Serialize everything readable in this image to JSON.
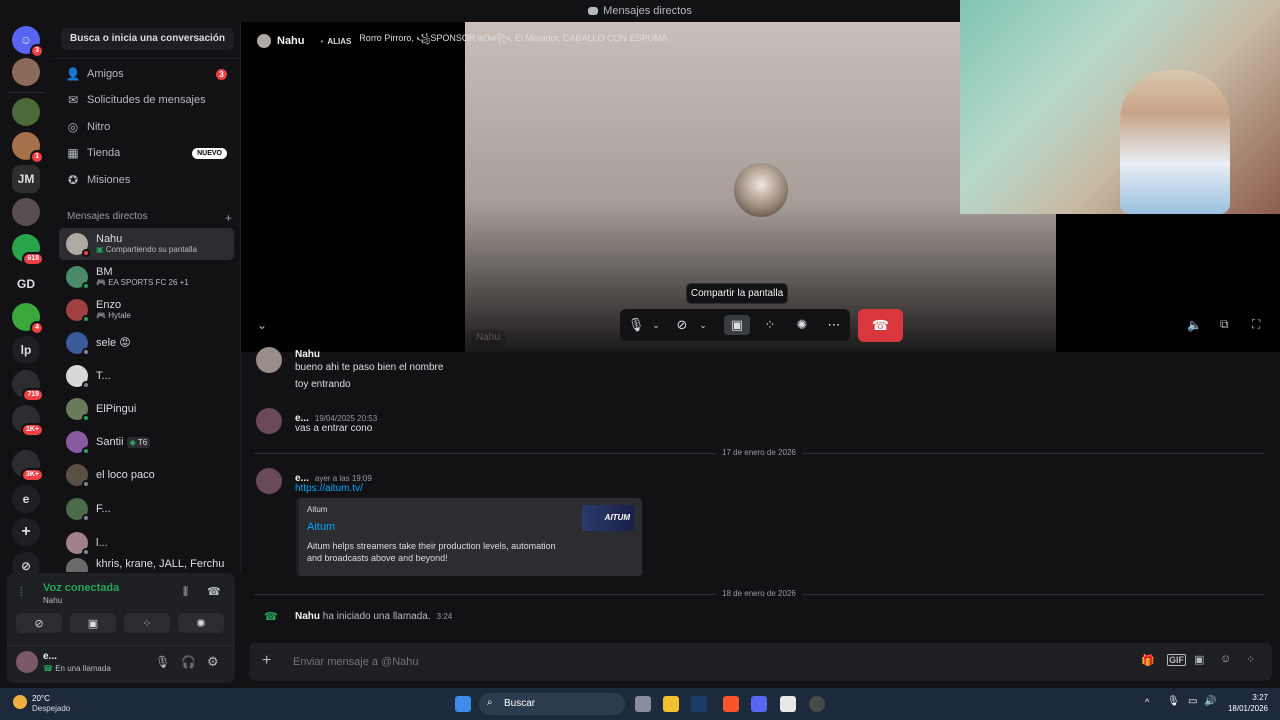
{
  "titlebar": {
    "title": "Mensajes directos"
  },
  "servers": [
    {
      "label": "",
      "badge": "3"
    },
    {
      "label": "",
      "badge": ""
    },
    {
      "label": "",
      "badge": ""
    },
    {
      "label": "",
      "badge": "1"
    },
    {
      "label": "JM",
      "badge": ""
    },
    {
      "label": "",
      "badge": ""
    },
    {
      "label": "",
      "badge": "618"
    },
    {
      "label": "GD",
      "badge": ""
    },
    {
      "label": "",
      "badge": "4"
    },
    {
      "label": "lp",
      "badge": ""
    },
    {
      "label": "",
      "badge": "719"
    },
    {
      "label": "",
      "badge": "1K+"
    },
    {
      "label": "",
      "badge": "3K+"
    },
    {
      "label": "e",
      "badge": ""
    },
    {
      "label": "+",
      "badge": ""
    },
    {
      "label": "⊘",
      "badge": ""
    }
  ],
  "sidebar": {
    "search": "Busca o inicia una conversación",
    "nav": [
      {
        "label": "Amigos",
        "badge": "3"
      },
      {
        "label": "Solicitudes de mensajes",
        "badge": ""
      },
      {
        "label": "Nitro",
        "badge": ""
      },
      {
        "label": "Tienda",
        "badge": "NUEVO"
      },
      {
        "label": "Misiones",
        "badge": ""
      }
    ],
    "dm_header": "Mensajes directos",
    "dm_add": "+",
    "dms": [
      {
        "name": "Nahu",
        "sub": "Compartiendo su pantalla"
      },
      {
        "name": "BM",
        "sub": "EA SPORTS FC 26 +1"
      },
      {
        "name": "Enzo",
        "sub": "Hytale"
      },
      {
        "name": "sele 😡",
        "sub": ""
      },
      {
        "name": "T...",
        "sub": ""
      },
      {
        "name": "ElPingui",
        "sub": ""
      },
      {
        "name": "Santii",
        "sub": "",
        "tag": "T6"
      },
      {
        "name": "el loco paco",
        "sub": ""
      },
      {
        "name": "F...",
        "sub": ""
      },
      {
        "name": "l...",
        "sub": ""
      },
      {
        "name": "khris, krane, JALL, Ferchu",
        "sub": ""
      }
    ]
  },
  "voice": {
    "status": "Voz conectada",
    "channel": "Nahu",
    "user": "e...",
    "user_sub": "En una llamada"
  },
  "call": {
    "name": "Nahu",
    "alias_label": "ALIAS",
    "aliases": "Rorro Pirroro, ꧁SPONSOR w0w꧂, El Matador, CABALLO CON ESPUMA",
    "screen_label": "Nahu",
    "tooltip": "Compartir la pantalla"
  },
  "chat": {
    "messages": [
      {
        "user": "Nahu",
        "time": "",
        "lines": [
          "bueno ahi te paso bien el nombre",
          "toy entrando"
        ]
      },
      {
        "user": "e...",
        "time": "19/04/2025 20:53",
        "lines": [
          "vas a entrar cono"
        ]
      },
      {
        "user": "e...",
        "time": "ayer a las 19:09",
        "lines": [
          "https://aitum.tv/"
        ]
      }
    ],
    "divider1": "17 de enero de 2026",
    "divider2": "18 de enero de 2026",
    "embed": {
      "provider": "Aitum",
      "title": "Aitum",
      "desc1": "Aitum helps streamers take their production levels, automation",
      "desc2": "and broadcasts above and beyond!",
      "thumb": "AITUM"
    },
    "call_log": {
      "user": "Nahu",
      "text": "ha iniciado una llamada.",
      "time": "3:24"
    },
    "composer_placeholder": "Enviar mensaje a @Nahu"
  },
  "taskbar": {
    "weather_temp": "20°C",
    "weather_desc": "Despejado",
    "search": "Buscar",
    "time": "3:27",
    "date": "18/01/2026"
  }
}
